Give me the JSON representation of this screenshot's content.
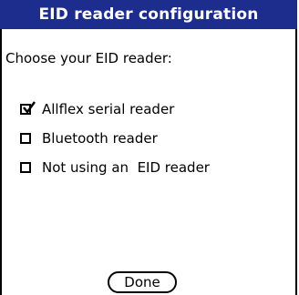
{
  "dialog": {
    "title": "EID reader configuration",
    "prompt": "Choose your EID reader:"
  },
  "options": [
    {
      "label": "Allflex serial reader",
      "checked": true
    },
    {
      "label": "Bluetooth reader",
      "checked": false
    },
    {
      "label": "Not using an  EID reader",
      "checked": false
    }
  ],
  "buttons": {
    "done_label": "Done"
  },
  "colors": {
    "titlebar": "#1d2d8d"
  }
}
